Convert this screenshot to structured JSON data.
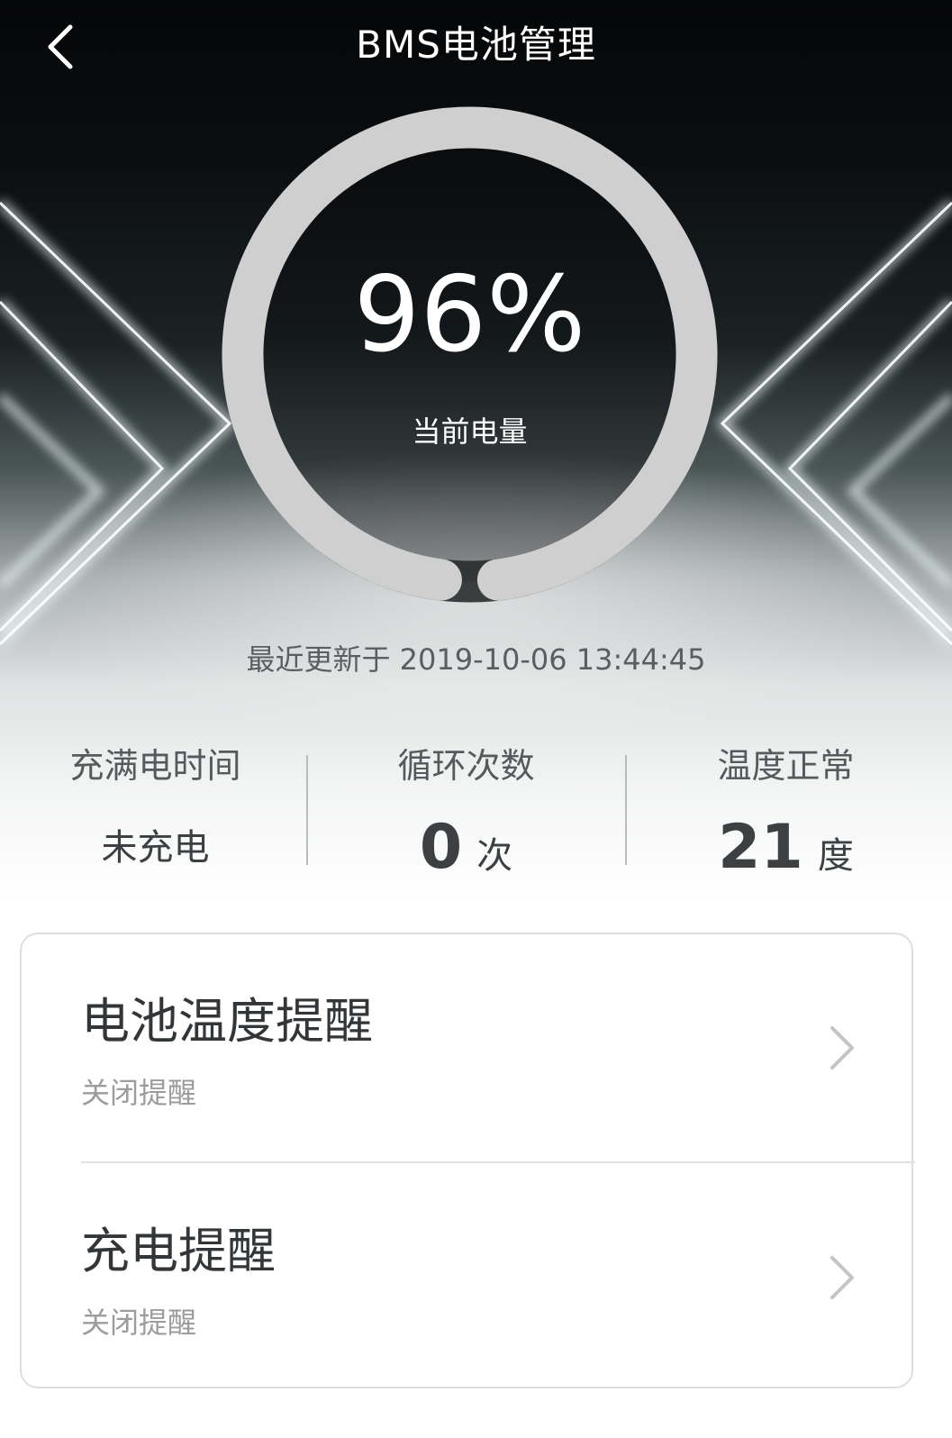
{
  "header": {
    "title": "BMS电池管理",
    "back_icon": "chevron-left-icon"
  },
  "battery": {
    "level_fraction": 0.96,
    "percent_text": "96%",
    "label": "当前电量",
    "ring_color": "#cfcfcf"
  },
  "updated": {
    "text": "最近更新于 2019-10-06 13:44:45"
  },
  "stats": [
    {
      "title": "充满电时间",
      "value": "未充电",
      "unit": ""
    },
    {
      "title": "循环次数",
      "value": "0",
      "unit": "次"
    },
    {
      "title": "温度正常",
      "value": "21",
      "unit": "度"
    }
  ],
  "settings": [
    {
      "title": "电池温度提醒",
      "subtitle": "关闭提醒",
      "icon": "chevron-right-icon"
    },
    {
      "title": "充电提醒",
      "subtitle": "关闭提醒",
      "icon": "chevron-right-icon"
    }
  ]
}
